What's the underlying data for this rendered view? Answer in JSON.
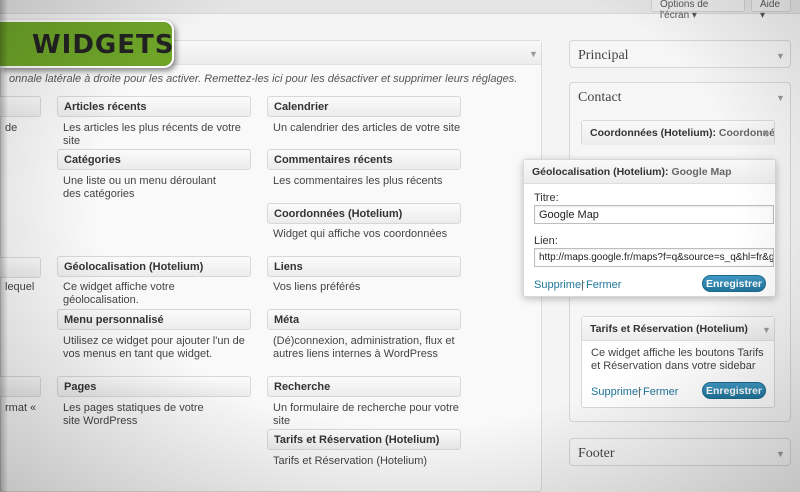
{
  "header": {
    "screen_options": "Options de l'écran",
    "help": "Aide"
  },
  "badge": {
    "title": "WIDGETS"
  },
  "available": {
    "description": "onnale latérale à droite pour les activer. Remettez-les ici pour les désactiver et supprimer leurs réglages.",
    "widgets": [
      {
        "title": "Articles récents",
        "desc": "Les articles les plus récents de votre site"
      },
      {
        "title": "Calendrier",
        "desc": "Un calendrier des articles de votre site"
      },
      {
        "title": "Catégories",
        "desc": "Une liste ou un menu déroulant des catégories"
      },
      {
        "title": "Commentaires récents",
        "desc": "Les commentaires les plus récents"
      },
      {
        "title": "Coordonnées (Hotelium)",
        "desc": "Widget qui affiche vos coordonnées"
      },
      {
        "title": "Géolocalisation (Hotelium)",
        "desc": "Ce widget affiche votre géolocalisation."
      },
      {
        "title": "Liens",
        "desc": "Vos liens préférés"
      },
      {
        "title": "Menu personnalisé",
        "desc": "Utilisez ce widget pour ajouter l'un de vos menus en tant que widget."
      },
      {
        "title": "Méta",
        "desc": "(Dé)connexion, administration, flux et autres liens internes à WordPress"
      },
      {
        "title": "Pages",
        "desc": "Les pages statiques de votre site WordPress"
      },
      {
        "title": "Recherche",
        "desc": "Un formulaire de recherche pour votre site"
      },
      {
        "title": "Tarifs et Réservation (Hotelium)",
        "desc": "Tarifs et Réservation (Hotelium)"
      }
    ],
    "cut_fragments": [
      "de",
      "lequel",
      "rmat «"
    ]
  },
  "sidebars": {
    "principal": "Principal",
    "contact": "Contact",
    "footer": "Footer"
  },
  "contact_widgets": {
    "coordonnees": {
      "title": "Coordonnées (Hotelium):",
      "subtitle": "Coordonnée"
    },
    "geoloc": {
      "title": "Géolocalisation (Hotelium):",
      "subtitle": "Google Map",
      "title_label": "Titre:",
      "title_value": "Google Map",
      "link_label": "Lien:",
      "link_value": "http://maps.google.fr/maps?f=q&source=s_q&hl=fr&geo",
      "delete": "Supprimer",
      "separator": "|",
      "close": "Fermer",
      "save": "Enregistrer"
    },
    "tarifs": {
      "title": "Tarifs et Réservation (Hotelium)",
      "desc": "Ce widget affiche les boutons Tarifs et Réservation dans votre sidebar",
      "delete": "Supprimer",
      "separator": "|",
      "close": "Fermer",
      "save": "Enregistrer"
    }
  }
}
